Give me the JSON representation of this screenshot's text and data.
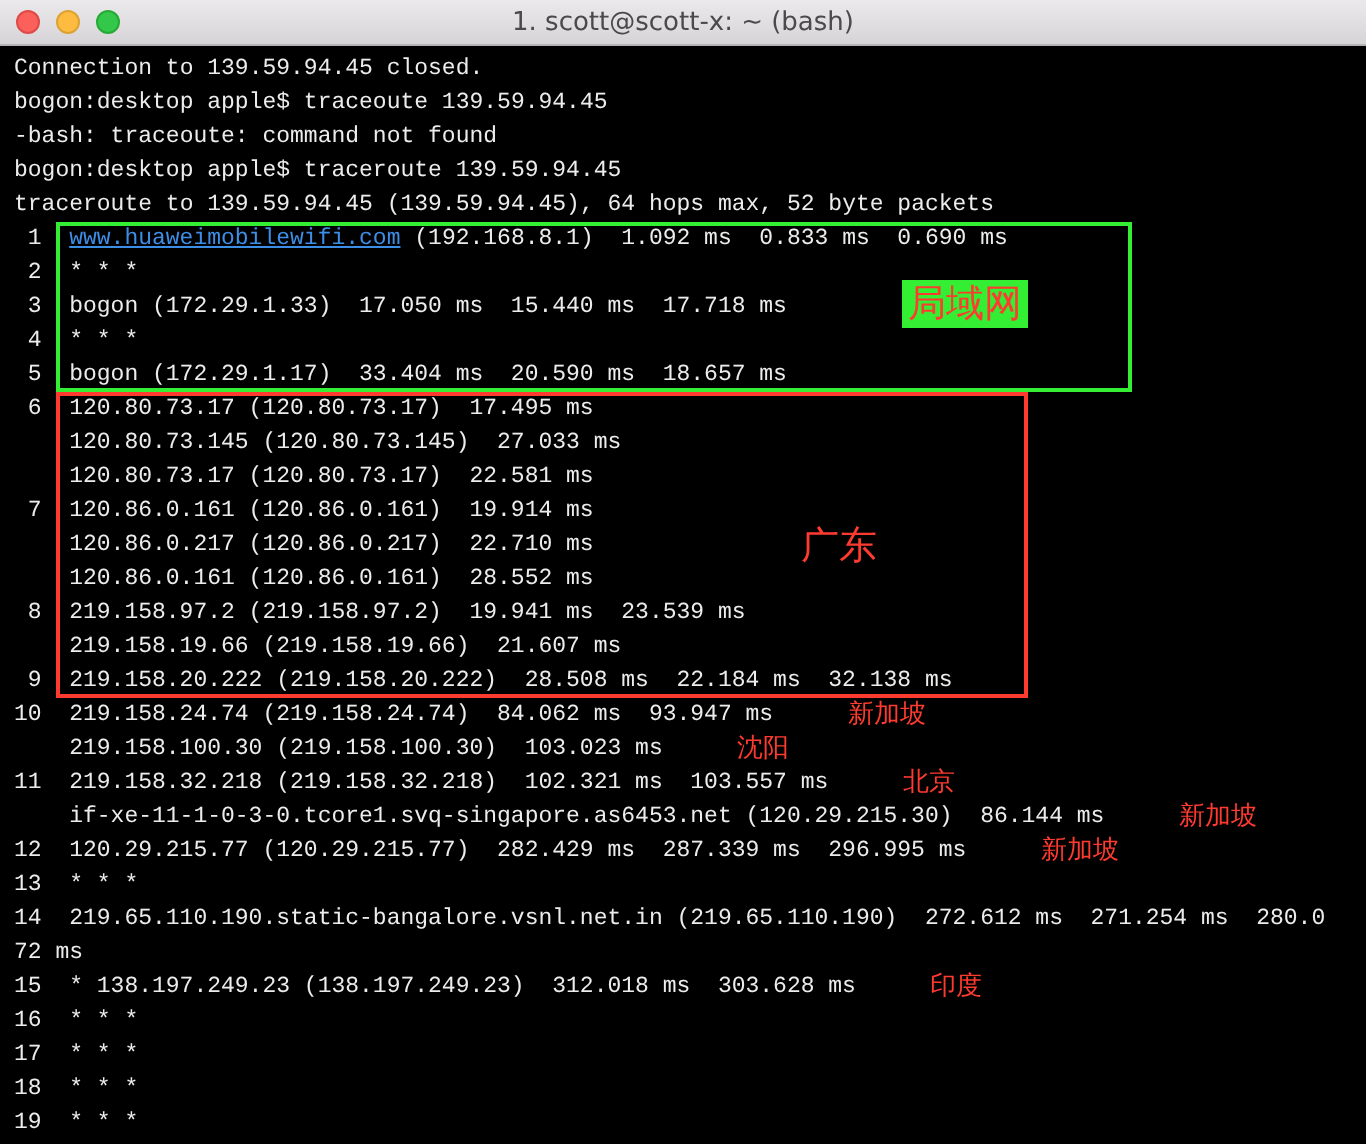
{
  "window": {
    "title": "1. scott@scott-x: ~ (bash)"
  },
  "terminal": {
    "blocks": [
      {
        "kind": "plain",
        "lines": [
          {
            "kind": "output",
            "text": "Connection to 139.59.94.45 closed."
          },
          {
            "kind": "output",
            "text": "bogon:desktop apple$ traceoute 139.59.94.45"
          },
          {
            "kind": "output",
            "text": "-bash: traceoute: command not found"
          },
          {
            "kind": "output",
            "text": "bogon:desktop apple$ traceroute 139.59.94.45"
          },
          {
            "kind": "output",
            "text": "traceroute to 139.59.94.45 (139.59.94.45), 64 hops max, 52 byte packets"
          }
        ]
      },
      {
        "kind": "framed",
        "color": "#33ee33",
        "label": "局域网",
        "label_filled": true,
        "lines": [
          {
            "kind": "hop",
            "number": "1",
            "link": "www.huaweimobilewifi.com",
            "text": " (192.168.8.1)  1.092 ms  0.833 ms  0.690 ms"
          },
          {
            "kind": "hop",
            "number": "2",
            "text": "* * *"
          },
          {
            "kind": "hop",
            "number": "3",
            "text": "bogon (172.29.1.33)  17.050 ms  15.440 ms  17.718 ms"
          },
          {
            "kind": "hop",
            "number": "4",
            "text": "* * *"
          },
          {
            "kind": "hop",
            "number": "5",
            "text": "bogon (172.29.1.17)  33.404 ms  20.590 ms  18.657 ms"
          }
        ]
      },
      {
        "kind": "framed",
        "color": "#ff3b30",
        "label": "广东",
        "label_filled": false,
        "lines": [
          {
            "kind": "hop",
            "number": "6",
            "text": "120.80.73.17 (120.80.73.17)  17.495 ms"
          },
          {
            "kind": "hop",
            "text": "120.80.73.145 (120.80.73.145)  27.033 ms"
          },
          {
            "kind": "hop",
            "text": "120.80.73.17 (120.80.73.17)  22.581 ms"
          },
          {
            "kind": "hop",
            "number": "7",
            "text": "120.86.0.161 (120.86.0.161)  19.914 ms"
          },
          {
            "kind": "hop",
            "text": "120.86.0.217 (120.86.0.217)  22.710 ms"
          },
          {
            "kind": "hop",
            "text": "120.86.0.161 (120.86.0.161)  28.552 ms"
          },
          {
            "kind": "hop",
            "number": "8",
            "text": "219.158.97.2 (219.158.97.2)  19.941 ms  23.539 ms"
          },
          {
            "kind": "hop",
            "text": "219.158.19.66 (219.158.19.66)  21.607 ms"
          },
          {
            "kind": "hop",
            "number": "9",
            "text": "219.158.20.222 (219.158.20.222)  28.508 ms  22.184 ms  32.138 ms"
          }
        ]
      },
      {
        "kind": "plain",
        "lines": [
          {
            "kind": "hop",
            "number": "10",
            "text": "219.158.24.74 (219.158.24.74)  84.062 ms  93.947 ms",
            "note": "新加坡"
          },
          {
            "kind": "hop",
            "text": "219.158.100.30 (219.158.100.30)  103.023 ms",
            "note": "沈阳"
          },
          {
            "kind": "hop",
            "number": "11",
            "text": "219.158.32.218 (219.158.32.218)  102.321 ms  103.557 ms",
            "note": "北京"
          },
          {
            "kind": "hop",
            "text": "if-xe-11-1-0-3-0.tcore1.svq-singapore.as6453.net (120.29.215.30)  86.144 ms",
            "note": "新加坡"
          },
          {
            "kind": "hop",
            "number": "12",
            "text": "120.29.215.77 (120.29.215.77)  282.429 ms  287.339 ms  296.995 ms",
            "note": "新加坡"
          },
          {
            "kind": "hop",
            "number": "13",
            "text": "* * *"
          },
          {
            "kind": "hop",
            "number": "14",
            "text": "219.65.110.190.static-bangalore.vsnl.net.in (219.65.110.190)  272.612 ms  271.254 ms  280.0"
          },
          {
            "kind": "output",
            "text": "72 ms"
          },
          {
            "kind": "hop",
            "number": "15",
            "text": "* 138.197.249.23 (138.197.249.23)  312.018 ms  303.628 ms",
            "note": "印度"
          },
          {
            "kind": "hop",
            "number": "16",
            "text": "* * *"
          },
          {
            "kind": "hop",
            "number": "17",
            "text": "* * *"
          },
          {
            "kind": "hop",
            "number": "18",
            "text": "* * *"
          },
          {
            "kind": "hop",
            "number": "19",
            "text": "* * *"
          }
        ]
      }
    ]
  }
}
